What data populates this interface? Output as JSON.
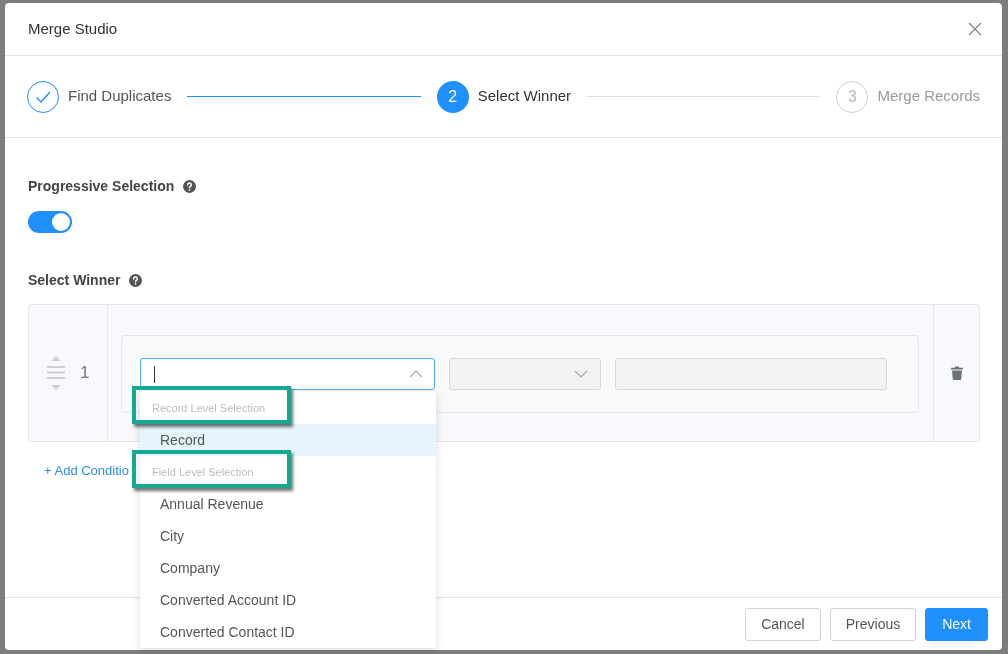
{
  "dialog": {
    "title": "Merge Studio"
  },
  "steps": [
    {
      "label": "Find Duplicates",
      "done": true,
      "selected": false
    },
    {
      "number": "2",
      "label": "Select Winner",
      "done": false,
      "selected": true
    },
    {
      "number": "3",
      "label": "Merge Records",
      "done": false,
      "selected": false
    }
  ],
  "progressive_selection": {
    "label": "Progressive Selection",
    "on": true
  },
  "select_winner": {
    "label": "Select Winner",
    "conditions": [
      {
        "number": "1",
        "field": {
          "expanded": true,
          "menu": {
            "groups": [
              {
                "title": "Record Level Selection",
                "highlighted": true,
                "options": [
                  {
                    "label": "Record",
                    "selected": true
                  }
                ]
              },
              {
                "title": "Field Level Selection",
                "highlighted": true,
                "options": [
                  {
                    "label": "Annual Revenue",
                    "selected": false
                  },
                  {
                    "label": "City",
                    "selected": false
                  },
                  {
                    "label": "Company",
                    "selected": false
                  },
                  {
                    "label": "Converted Account ID",
                    "selected": false
                  },
                  {
                    "label": "Converted Contact ID",
                    "selected": false
                  }
                ]
              }
            ]
          }
        },
        "operator": {
          "disabled": true
        },
        "value": {
          "disabled": true
        }
      }
    ],
    "add_condition": "+ Add Conditio"
  },
  "buttons": [
    {
      "label": "Cancel",
      "kind": "secondary"
    },
    {
      "label": "Previous",
      "kind": "secondary"
    },
    {
      "label": "Next",
      "kind": "primary"
    }
  ]
}
